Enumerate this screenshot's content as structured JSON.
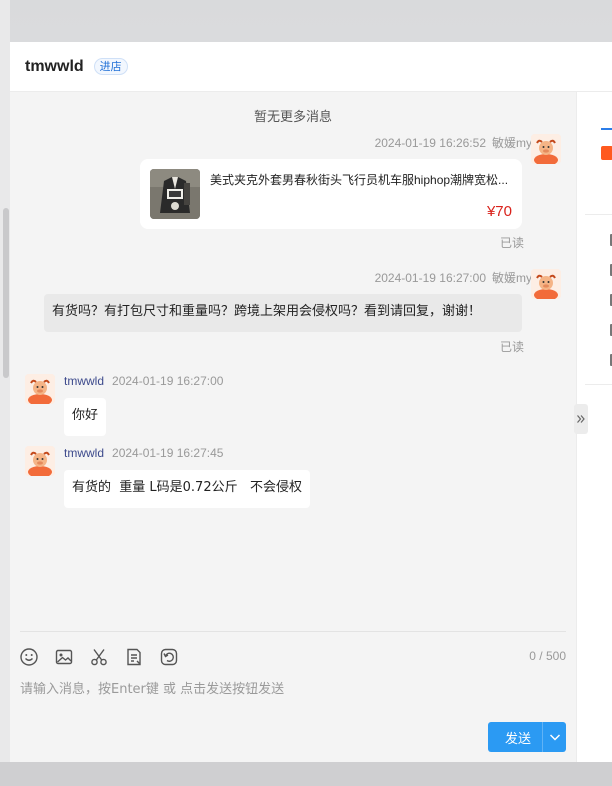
{
  "header": {
    "shop_name": "tmwwld",
    "enter_shop_label": "进店"
  },
  "chat": {
    "no_more_text": "暂无更多消息",
    "messages": [
      {
        "type": "product",
        "sender": "敏媛my",
        "time": "2024-01-19 16:26:52",
        "product_title": "美式夹克外套男春秋街头飞行员机车服hiphop潮牌宽松...",
        "price": "¥70",
        "status": "已读"
      },
      {
        "type": "text",
        "sender": "敏媛my",
        "time": "2024-01-19 16:27:00",
        "text": "有货吗？有打包尺寸和重量吗？跨境上架用会侵权吗？看到请回复，谢谢！",
        "status": "已读"
      },
      {
        "type": "text",
        "sender": "tmwwld",
        "time": "2024-01-19 16:27:00",
        "text": "你好"
      },
      {
        "type": "text",
        "sender": "tmwwld",
        "time": "2024-01-19 16:27:45",
        "text": "有货的  重量 L码是0.72公斤   不会侵权"
      }
    ]
  },
  "composer": {
    "tools": [
      "emoji-icon",
      "image-icon",
      "scissors-icon",
      "order-icon",
      "history-icon"
    ],
    "counter": "0 / 500",
    "placeholder": "请输入消息，按Enter键 或 点击发送按钮发送",
    "send_label": "发送"
  },
  "colors": {
    "accent": "#2b9af3",
    "price": "#d9221b",
    "chat_bg": "#f4f4f4"
  }
}
